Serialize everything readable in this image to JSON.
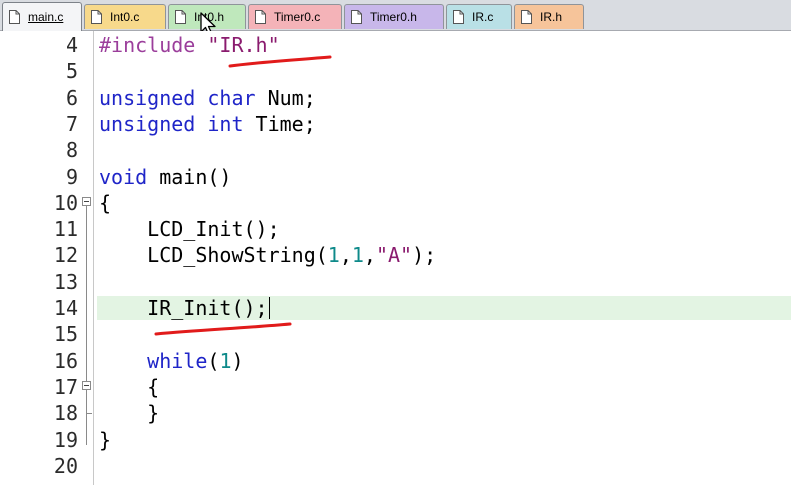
{
  "tabs": [
    {
      "label": "main.c",
      "color": "#f4f5f7",
      "active": true
    },
    {
      "label": "Int0.c",
      "color": "#f7d98b",
      "active": false
    },
    {
      "label": "Int0.h",
      "color": "#bfe8bc",
      "active": false
    },
    {
      "label": "Timer0.c",
      "color": "#f4b3b8",
      "active": false
    },
    {
      "label": "Timer0.h",
      "color": "#c8b7ea",
      "active": false
    },
    {
      "label": "IR.c",
      "color": "#b9e0e6",
      "active": false
    },
    {
      "label": "IR.h",
      "color": "#f6c49a",
      "active": false
    }
  ],
  "editor": {
    "current_line": "14",
    "lines": [
      {
        "num": "4",
        "code": "#include \"IR.h\""
      },
      {
        "num": "5",
        "code": ""
      },
      {
        "num": "6",
        "code": "unsigned char Num;"
      },
      {
        "num": "7",
        "code": "unsigned int Time;"
      },
      {
        "num": "8",
        "code": ""
      },
      {
        "num": "9",
        "code": "void main()"
      },
      {
        "num": "10",
        "code": "{"
      },
      {
        "num": "11",
        "code": "    LCD_Init();"
      },
      {
        "num": "12",
        "code": "    LCD_ShowString(1,1,\"A\");"
      },
      {
        "num": "13",
        "code": ""
      },
      {
        "num": "14",
        "code": "    IR_Init();"
      },
      {
        "num": "15",
        "code": ""
      },
      {
        "num": "16",
        "code": "    while(1)"
      },
      {
        "num": "17",
        "code": "    {"
      },
      {
        "num": "18",
        "code": "    }"
      },
      {
        "num": "19",
        "code": "}"
      },
      {
        "num": "20",
        "code": ""
      }
    ]
  },
  "colors": {
    "keyword": "#1f25c8",
    "preprocessor": "#9b3e9b",
    "string": "#8a1b6e",
    "number": "#0e8a8a",
    "current_line_bg": "#e3f4e3",
    "annotation": "#e11b1b"
  },
  "icons": {
    "tab_file": "file-icon",
    "mouse": "mouse-pointer-icon"
  }
}
